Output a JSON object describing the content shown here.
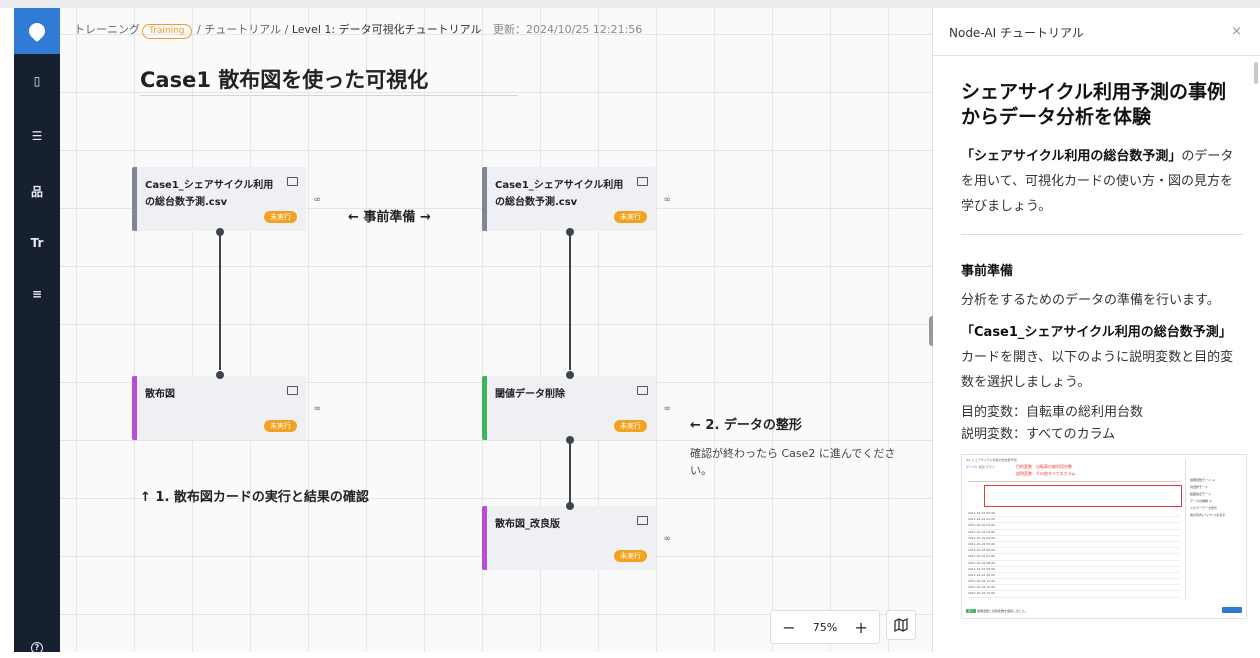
{
  "sidebar": {
    "items": [
      {
        "icon": "document-icon",
        "glyph": "▯"
      },
      {
        "icon": "database-icon",
        "glyph": "☰"
      },
      {
        "icon": "hierarchy-icon",
        "glyph": "品"
      },
      {
        "icon": "text-icon",
        "glyph": "Tr"
      },
      {
        "icon": "list-edit-icon",
        "glyph": "≡"
      }
    ],
    "help_glyph": "?"
  },
  "breadcrumb": {
    "training": "トレーニング",
    "training_badge": "Training",
    "sep1": "/",
    "tutorial": "チュートリアル",
    "sep2": "/",
    "current": "Level 1: データ可視化チュートリアル",
    "updated": "更新：2024/10/25 12:21:56"
  },
  "canvas": {
    "title": "Case1 散布図を使った可視化",
    "nodes": {
      "csv_left": {
        "title": "Case1_シェアサイクル利用の総台数予測.csv",
        "status": "未実行"
      },
      "csv_right": {
        "title": "Case1_シェアサイクル利用の総台数予測.csv",
        "status": "未実行"
      },
      "scatter": {
        "title": "散布図",
        "status": "未実行"
      },
      "threshold": {
        "title": "閾値データ削除",
        "status": "未実行"
      },
      "scatter_improved": {
        "title": "散布図_改良版",
        "status": "未実行"
      }
    },
    "annotations": {
      "prep": "← 事前準備 →",
      "step1": "↑ 1. 散布図カードの実行と結果の確認",
      "step2": "← 2. データの整形",
      "note": "確認が終わったら Case2 に進んでください。"
    },
    "zoom": {
      "minus": "−",
      "level": "75%",
      "plus": "+"
    }
  },
  "panel": {
    "title": "Node-AI チュートリアル",
    "close": "×",
    "heading": "シェアサイクル利用予測の事例からデータ分析を体験",
    "intro_bold": "「シェアサイクル利用の総台数予測」",
    "intro_rest": "のデータを用いて、可視化カードの使い方・図の見方を学びましょう。",
    "section_title": "事前準備",
    "section_text": "分析をするためのデータの準備を行います。",
    "card_bold": "「Case1_シェアサイクル利用の総台数予測」",
    "card_rest": "カードを開き、以下のように説明変数と目的変数を選択しましょう。",
    "target": "目的変数：自転車の総利用台数",
    "explanatory": "説明変数：すべてのカラム"
  },
  "thumbnail": {
    "header": "Q1_シェアサイクル利用の総台数予測",
    "tabs": [
      "サンプル",
      "統計",
      "グラフ"
    ],
    "highlight_line1": "目的変数：自転車の総利用台数",
    "highlight_line2": "説明変数：その他すべてのカラム",
    "side_title1": "説明変数モード ≡",
    "side_opt1": "列選択モード",
    "side_opt2": "範囲指定モード",
    "side_title2": "データの種類 ≡",
    "side_opt3": "スカラーデータ形式",
    "side_opt4": "他の形式(バイナリ)を表示",
    "footer_badge": "完了",
    "footer_text": "説明変数と目的変数を保存しました。",
    "rows": [
      "2011-01-01 00:00",
      "2011-01-01 01:00",
      "2011-01-01 02:00",
      "2011-01-01 03:00",
      "2011-01-01 04:00",
      "2011-01-01 05:00",
      "2011-01-01 06:00",
      "2011-01-01 07:00",
      "2011-01-01 08:00",
      "2011-01-01 09:00",
      "2011-01-01 10:00",
      "2011-01-01 11:00",
      "2011-01-01 12:00",
      "2011-01-01 13:00"
    ]
  }
}
